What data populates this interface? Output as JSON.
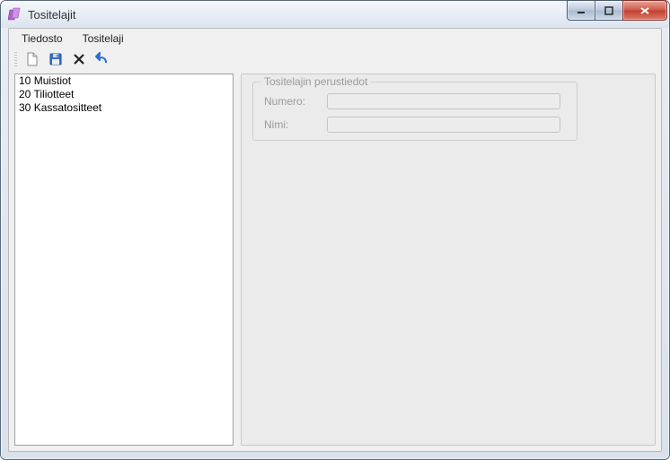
{
  "window": {
    "title": "Tositelajit"
  },
  "menu": {
    "file": "Tiedosto",
    "kind": "Tositelaji"
  },
  "list": {
    "items": [
      {
        "code": "10",
        "name": "Muistiot"
      },
      {
        "code": "20",
        "name": "Tiliotteet"
      },
      {
        "code": "30",
        "name": "Kassatositteet"
      }
    ]
  },
  "details": {
    "group_title": "Tositelajin perustiedot",
    "labels": {
      "numero": "Numero:",
      "nimi": "Nimi:"
    },
    "values": {
      "numero": "",
      "nimi": ""
    }
  }
}
